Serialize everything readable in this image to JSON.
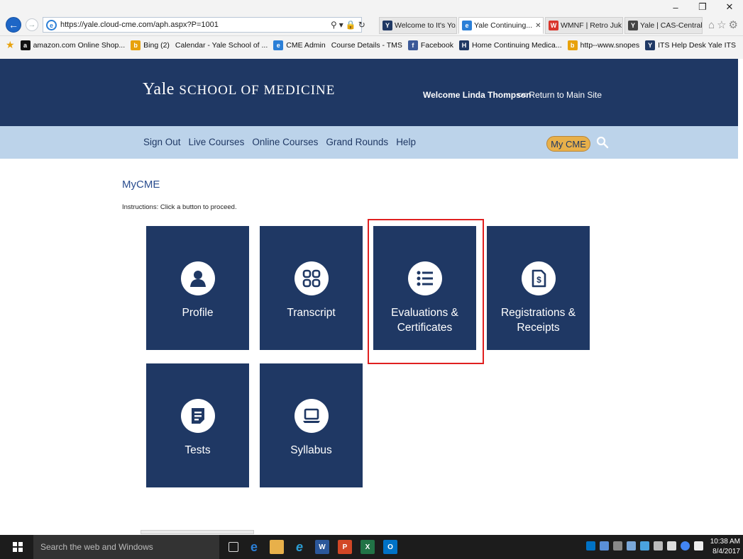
{
  "browser": {
    "url": "https://yale.cloud-cme.com/aph.aspx?P=1001",
    "tabs": [
      {
        "label": "Welcome to It's Yo...",
        "fav": "Y",
        "color": "#1f3864",
        "active": false
      },
      {
        "label": "Yale Continuing...",
        "fav": "e",
        "color": "#2b7fd7",
        "active": true
      },
      {
        "label": "WMNF | Retro Juk...",
        "fav": "W",
        "color": "#d9352b",
        "active": false
      },
      {
        "label": "Yale | CAS-Central ...",
        "fav": "Y",
        "color": "#444444",
        "active": false
      }
    ],
    "favorites": [
      {
        "label": "amazon.com Online Shop...",
        "fav": "a",
        "color": "#111111"
      },
      {
        "label": "Bing (2)",
        "fav": "b",
        "color": "#e8a20c"
      },
      {
        "label": "Calendar - Yale School of ...",
        "fav": "",
        "color": "#f3f3f3"
      },
      {
        "label": "CME Admin",
        "fav": "e",
        "color": "#2b7fd7"
      },
      {
        "label": "Course Details - TMS",
        "fav": "",
        "color": "#f3f3f3"
      },
      {
        "label": "Facebook",
        "fav": "f",
        "color": "#3b5998"
      },
      {
        "label": "Home Continuing Medica...",
        "fav": "H",
        "color": "#1f3864"
      },
      {
        "label": "http--www.snopes",
        "fav": "b",
        "color": "#e8a20c"
      },
      {
        "label": "ITS Help Desk Yale ITS",
        "fav": "Y",
        "color": "#1f3864"
      }
    ]
  },
  "header": {
    "logo_main": "Yale",
    "logo_sub": "SCHOOL OF MEDICINE",
    "welcome": "Welcome Linda Thompson",
    "return_link": "<< Return to Main Site"
  },
  "nav": {
    "links": [
      "Sign Out",
      "Live Courses",
      "Online Courses",
      "Grand Rounds",
      "Help"
    ],
    "mycme_label": "My CME"
  },
  "main": {
    "title": "MyCME",
    "instructions": "Instructions: Click a button to proceed.",
    "tiles": [
      {
        "label": "Profile",
        "icon": "user-icon"
      },
      {
        "label": "Transcript",
        "icon": "grid-icon"
      },
      {
        "label": "Evaluations & Certificates",
        "icon": "list-icon"
      },
      {
        "label": "Registrations & Receipts",
        "icon": "receipt-icon"
      },
      {
        "label": "Tests",
        "icon": "test-icon"
      },
      {
        "label": "Syllabus",
        "icon": "laptop-icon"
      }
    ]
  },
  "taskbar": {
    "search_placeholder": "Search the web and Windows",
    "time": "10:38 AM",
    "date": "8/4/2017"
  },
  "colors": {
    "brand_navy": "#1f3864",
    "nav_blue": "#bcd3ea",
    "accent_gold": "#e8b04a",
    "highlight_red": "#e02020"
  }
}
